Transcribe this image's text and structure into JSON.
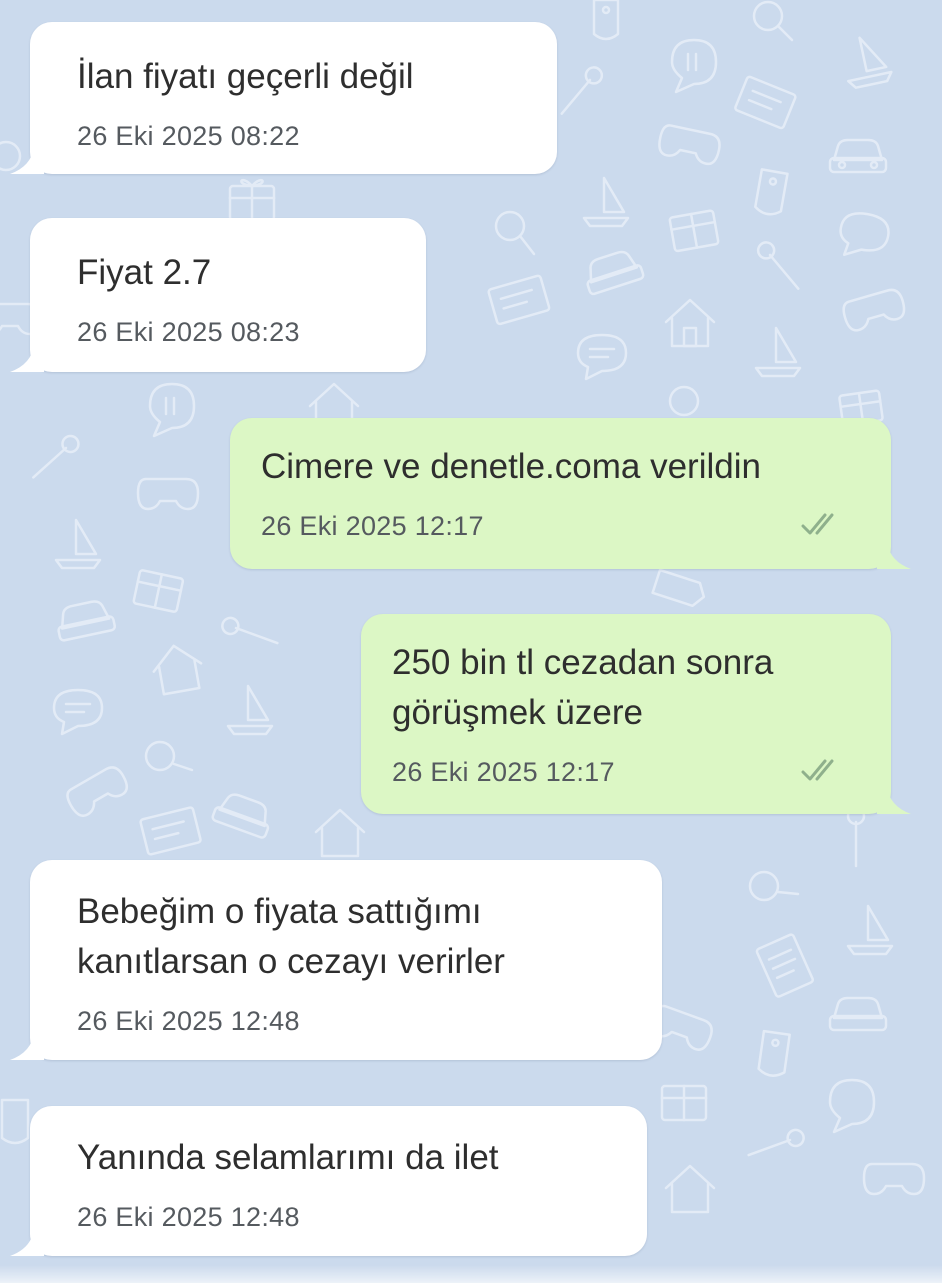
{
  "chat": {
    "messages": [
      {
        "direction": "in",
        "text": "İlan fiyatı geçerli değil",
        "time": "26 Eki 2025 08:22"
      },
      {
        "direction": "in",
        "text": "Fiyat 2.7",
        "time": "26 Eki 2025 08:23"
      },
      {
        "direction": "out",
        "text": "Cimere ve denetle.coma verildin",
        "time": "26 Eki 2025 12:17",
        "status": "read-double-check"
      },
      {
        "direction": "out",
        "text": "250 bin tl cezadan sonra\ngörüşmek üzere",
        "time": "26 Eki 2025 12:17",
        "status": "read-double-check"
      },
      {
        "direction": "in",
        "text": "Bebeğim o fiyata sattığımı\nkanıtlarsan o cezayı verirler",
        "time": "26 Eki 2025 12:48"
      },
      {
        "direction": "in",
        "text": "Yanında selamlarımı da ilet",
        "time": "26 Eki 2025 12:48"
      }
    ]
  },
  "theme": {
    "background": "#cbdaed",
    "incoming_bubble": "#ffffff",
    "outgoing_bubble": "#dcf7c5",
    "text_color": "#2e2e2e",
    "time_color": "#555a5f",
    "check_color": "#8fb08c",
    "wallpaper_icons": [
      "gift-icon",
      "car-icon",
      "tag-icon",
      "wrench-icon",
      "search-icon",
      "sailboat-icon",
      "gamepad-icon",
      "chat-bubble-icon",
      "house-icon",
      "laptop-icon"
    ]
  }
}
